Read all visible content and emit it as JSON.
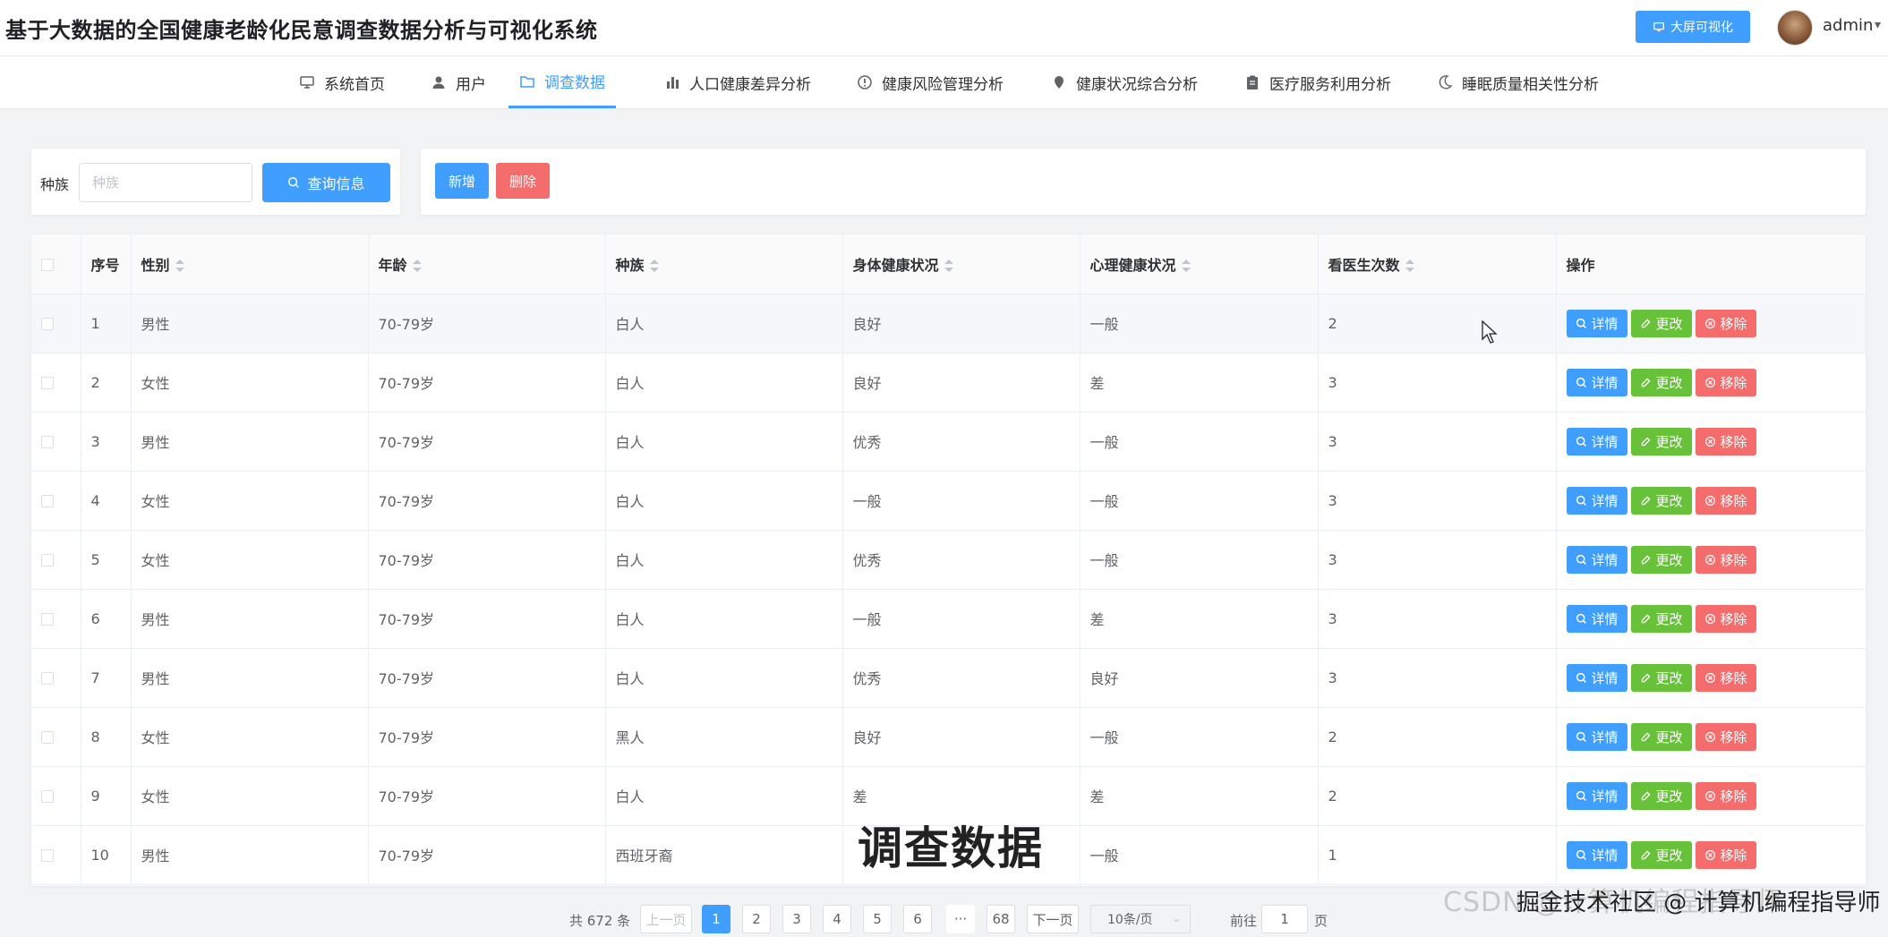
{
  "app": {
    "title": "基于大数据的全国健康老龄化民意调查数据分析与可视化系统",
    "screen_button": "大屏可视化",
    "user_name": "admin"
  },
  "nav": [
    {
      "label": "系统首页",
      "icon": "monitor-icon"
    },
    {
      "label": "用户",
      "icon": "user-icon"
    },
    {
      "label": "调查数据",
      "icon": "folder-icon",
      "active": true
    },
    {
      "label": "人口健康差异分析",
      "icon": "bar-chart-icon"
    },
    {
      "label": "健康风险管理分析",
      "icon": "info-circle-icon"
    },
    {
      "label": "健康状况综合分析",
      "icon": "map-pin-icon"
    },
    {
      "label": "医疗服务利用分析",
      "icon": "clipboard-icon"
    },
    {
      "label": "睡眠质量相关性分析",
      "icon": "moon-icon"
    }
  ],
  "search": {
    "label": "种族",
    "placeholder": "种族",
    "value": "",
    "button": "查询信息"
  },
  "actions": {
    "add": "新增",
    "delete": "删除"
  },
  "table": {
    "columns": [
      "序号",
      "性别",
      "年龄",
      "种族",
      "身体健康状况",
      "心理健康状况",
      "看医生次数",
      "操作"
    ],
    "rows": [
      {
        "no": "1",
        "gender": "男性",
        "age": "70-79岁",
        "race": "白人",
        "physical": "良好",
        "mental": "一般",
        "visits": "2"
      },
      {
        "no": "2",
        "gender": "女性",
        "age": "70-79岁",
        "race": "白人",
        "physical": "良好",
        "mental": "差",
        "visits": "3"
      },
      {
        "no": "3",
        "gender": "男性",
        "age": "70-79岁",
        "race": "白人",
        "physical": "优秀",
        "mental": "一般",
        "visits": "3"
      },
      {
        "no": "4",
        "gender": "女性",
        "age": "70-79岁",
        "race": "白人",
        "physical": "一般",
        "mental": "一般",
        "visits": "3"
      },
      {
        "no": "5",
        "gender": "女性",
        "age": "70-79岁",
        "race": "白人",
        "physical": "优秀",
        "mental": "一般",
        "visits": "3"
      },
      {
        "no": "6",
        "gender": "男性",
        "age": "70-79岁",
        "race": "白人",
        "physical": "一般",
        "mental": "差",
        "visits": "3"
      },
      {
        "no": "7",
        "gender": "男性",
        "age": "70-79岁",
        "race": "白人",
        "physical": "优秀",
        "mental": "良好",
        "visits": "3"
      },
      {
        "no": "8",
        "gender": "女性",
        "age": "70-79岁",
        "race": "黑人",
        "physical": "良好",
        "mental": "一般",
        "visits": "2"
      },
      {
        "no": "9",
        "gender": "女性",
        "age": "70-79岁",
        "race": "白人",
        "physical": "差",
        "mental": "差",
        "visits": "2"
      },
      {
        "no": "10",
        "gender": "男性",
        "age": "70-79岁",
        "race": "西班牙裔",
        "physical": "",
        "mental": "一般",
        "visits": "1"
      }
    ],
    "row_ops": {
      "detail": "详情",
      "edit": "更改",
      "remove": "移除"
    }
  },
  "pagination": {
    "total": "共 672 条",
    "prev": "上一页",
    "pages": [
      "1",
      "2",
      "3",
      "4",
      "5",
      "6"
    ],
    "ellipsis": "···",
    "last_page": "68",
    "next": "下一页",
    "page_size": "10条/页",
    "goto_label": "前往",
    "goto_value": "1",
    "goto_suffix": "页",
    "current": "1"
  },
  "overlay": {
    "subtitle": "调查数据",
    "watermark": "CSDN @计算机编程指导师",
    "watermark_juejin": "掘金技术社区 @ 计算机编程指导师"
  },
  "colors": {
    "primary": "#409eff",
    "success": "#67c23a",
    "danger": "#f56c6c"
  }
}
